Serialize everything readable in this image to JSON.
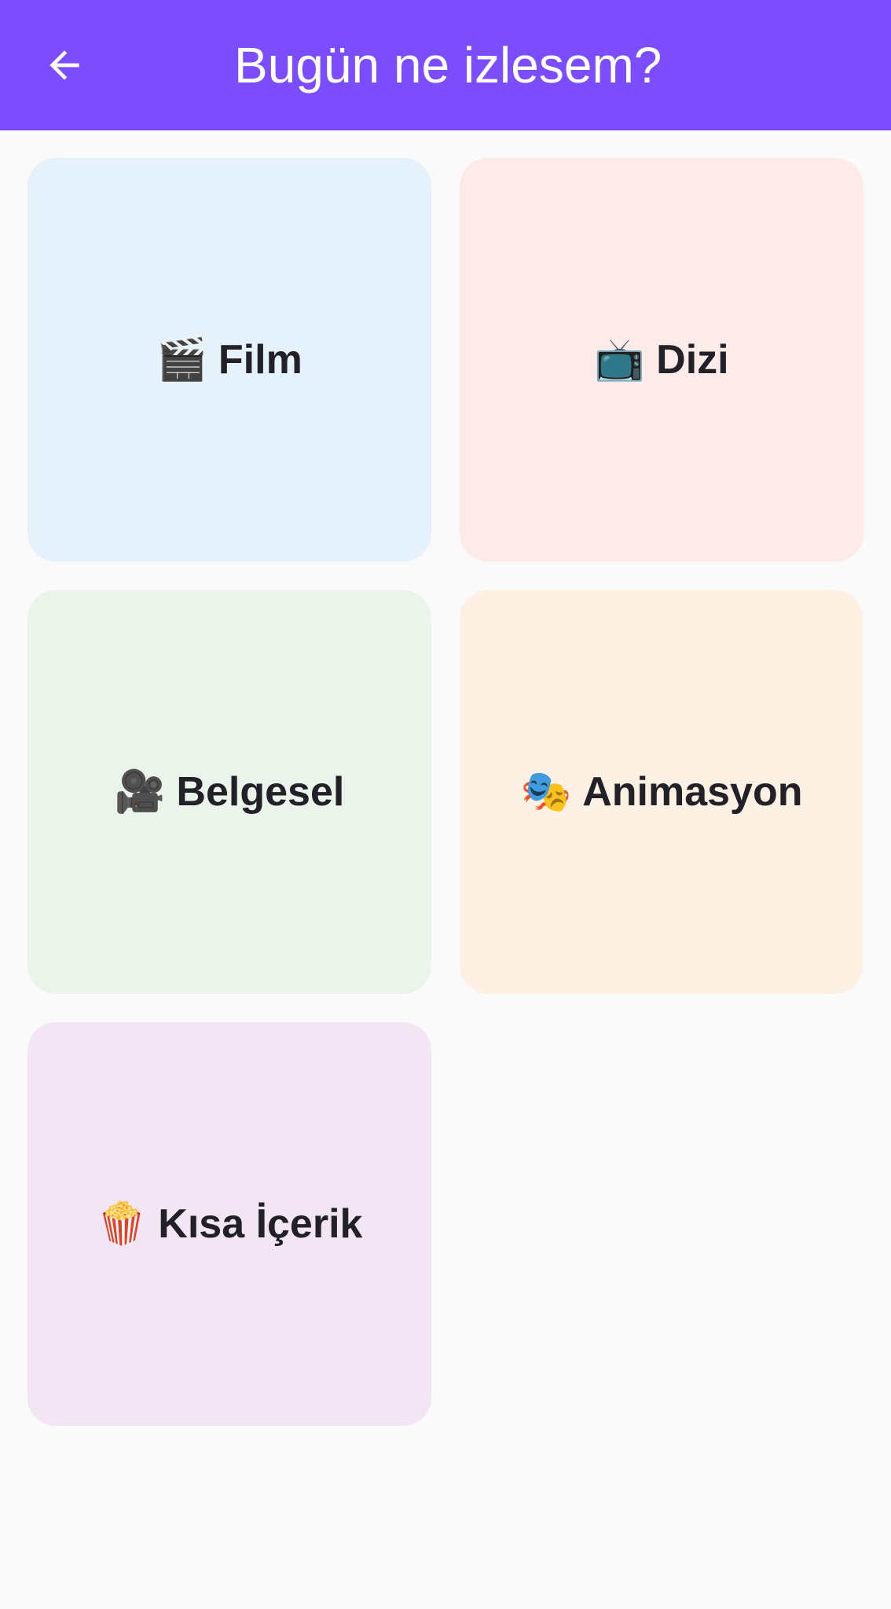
{
  "app_bar": {
    "title": "Bugün ne izlesem?",
    "back_icon": "arrow-back-icon",
    "color": "#7c4dff"
  },
  "categories": [
    {
      "emoji": "🎬",
      "icon": "clapper-board-icon",
      "label": "Film",
      "background": "#e5f2fb"
    },
    {
      "emoji": "📺",
      "icon": "television-icon",
      "label": "Dizi",
      "background": "#fcebe8"
    },
    {
      "emoji": "🎥",
      "icon": "movie-camera-icon",
      "label": "Belgesel",
      "background": "#ebf4eb"
    },
    {
      "emoji": "🎭",
      "icon": "theater-masks-icon",
      "label": "Animasyon",
      "background": "#fdf1e3"
    },
    {
      "emoji": "🍿",
      "icon": "popcorn-icon",
      "label": "Kısa İçerik",
      "background": "#f2e6f4"
    }
  ]
}
